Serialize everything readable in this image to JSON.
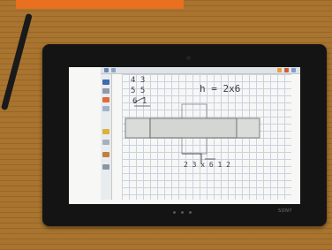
{
  "scene": {
    "colors": {
      "wood": "#a8742f",
      "bezel": "#141414",
      "screen": "#f7f7f5",
      "ink": "#3a3f4a",
      "accent": "#e8701f"
    }
  },
  "screen_handwriting": {
    "formula": "h = 2x6",
    "fraction_top": "4 3",
    "fraction_bottom": "5 5",
    "margin_note": "6 1",
    "bottom_note": "2 3 x 6 1 2"
  },
  "device": {
    "brand_label": "SONY"
  }
}
